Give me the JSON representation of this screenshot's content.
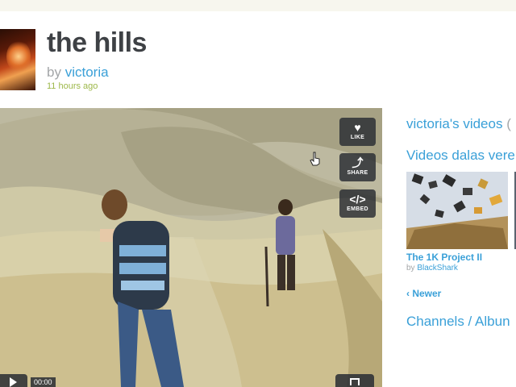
{
  "video": {
    "title": "the hills",
    "by_prefix": "by",
    "author": "victoria",
    "posted": "11 hours ago",
    "timecode": "00:00"
  },
  "player_actions": [
    {
      "label": "LIKE",
      "icon": "heart-icon"
    },
    {
      "label": "SHARE",
      "icon": "share-icon"
    },
    {
      "label": "EMBED",
      "icon": "embed-icon"
    }
  ],
  "sidebar": {
    "user_videos_heading": "victoria's videos",
    "user_videos_count_fragment": "(",
    "related_heading": "Videos dalas vere",
    "related_videos": [
      {
        "title": "The 1K Project II",
        "by_prefix": "by",
        "author": "BlackShark"
      }
    ],
    "newer_label": "‹ Newer",
    "channels_heading": "Channels / Albun"
  },
  "colors": {
    "link": "#3aa0d8",
    "title": "#3e4145",
    "muted": "#a3a6a8",
    "timestamp": "#9db84a",
    "overlay": "#282c32"
  }
}
